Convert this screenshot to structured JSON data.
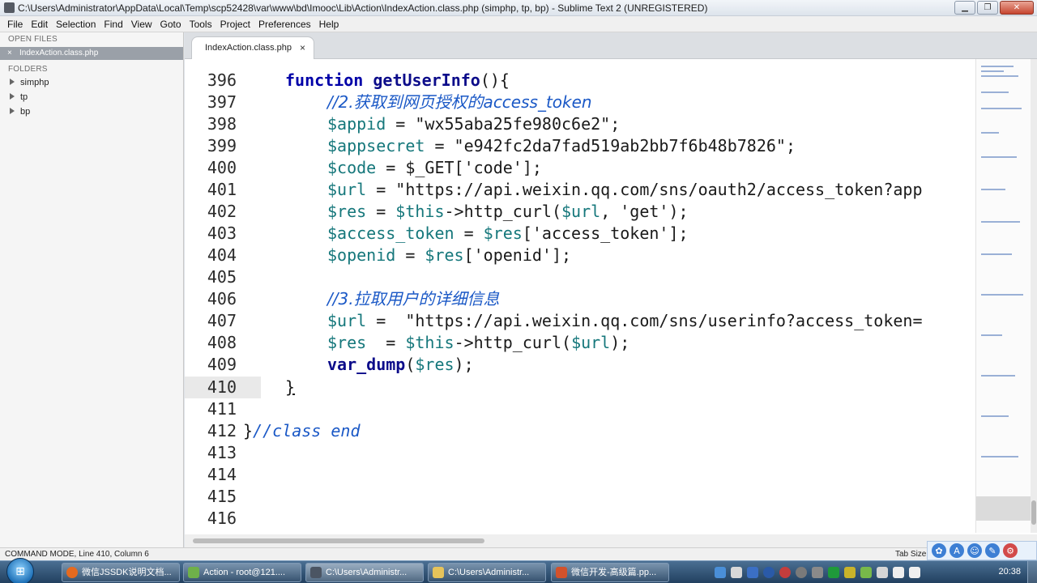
{
  "window": {
    "title": "C:\\Users\\Administrator\\AppData\\Local\\Temp\\scp52428\\var\\www\\bd\\Imooc\\Lib\\Action\\IndexAction.class.php (simphp, tp, bp) - Sublime Text 2 (UNREGISTERED)",
    "minimize": "▁",
    "maximize": "❐",
    "close": "✕"
  },
  "menu": [
    "File",
    "Edit",
    "Selection",
    "Find",
    "View",
    "Goto",
    "Tools",
    "Project",
    "Preferences",
    "Help"
  ],
  "sidebar": {
    "open_files_heading": "OPEN FILES",
    "open_file": "IndexAction.class.php",
    "open_file_close": "×",
    "folders_heading": "FOLDERS",
    "folders": [
      "simphp",
      "tp",
      "bp"
    ]
  },
  "tab": {
    "label": "IndexAction.class.php",
    "close": "×"
  },
  "code": {
    "line_numbers": [
      "396",
      "397",
      "398",
      "399",
      "400",
      "401",
      "402",
      "403",
      "404",
      "405",
      "406",
      "407",
      "408",
      "409",
      "410",
      "411",
      "412",
      "413",
      "414",
      "415",
      "416"
    ],
    "active_line": "410",
    "tokens": {
      "l396_kw": "function",
      "l396_fn": "getUserInfo",
      "l396_rest": "(){",
      "l397": "//2.获取到网页授权的access_token",
      "l398_var": "$appid",
      "l398_rest": " = \"wx55aba25fe980c6e2\";",
      "l399_var": "$appsecret",
      "l399_rest": " = \"e942fc2da7fad519ab2bb7f6b48b7826\";",
      "l400_var": "$code",
      "l400_rest": " = $_GET['code'];",
      "l401_var": "$url",
      "l401_rest": " = \"https://api.weixin.qq.com/sns/oauth2/access_token?app",
      "l402_var": "$res",
      "l402_mid": " = ",
      "l402_var2": "$this",
      "l402_mid2": "->http_curl(",
      "l402_var3": "$url",
      "l402_rest": ", 'get');",
      "l403_var": "$access_token",
      "l403_mid": " = ",
      "l403_var2": "$res",
      "l403_rest": "['access_token'];",
      "l404_var": "$openid",
      "l404_mid": " = ",
      "l404_var2": "$res",
      "l404_rest": "['openid'];",
      "l406": "//3.拉取用户的详细信息",
      "l407_var": "$url",
      "l407_rest": " =  \"https://api.weixin.qq.com/sns/userinfo?access_token=",
      "l408_var": "$res",
      "l408_mid": "  = ",
      "l408_var2": "$this",
      "l408_mid2": "->http_curl(",
      "l408_var3": "$url",
      "l408_rest": ");",
      "l409_fn": "var_dump",
      "l409_mid": "(",
      "l409_var": "$res",
      "l409_rest": ");",
      "l410": "}",
      "l412_brace": "}",
      "l412_comment": "//class end"
    }
  },
  "status": {
    "left": "COMMAND MODE, Line 410, Column 6",
    "right": "Tab Size"
  },
  "taskbar": {
    "items": [
      "微信JSSDK说明文档...",
      "Action - root@121....",
      "C:\\Users\\Administr...",
      "C:\\Users\\Administr...",
      "微信开发-高级篇.pp..."
    ],
    "clock": "20:38"
  },
  "colors": {
    "keyword": "#0000a8",
    "comment": "#1a58c6",
    "variable": "#15777b",
    "taskbar": "#2b4a6b"
  }
}
